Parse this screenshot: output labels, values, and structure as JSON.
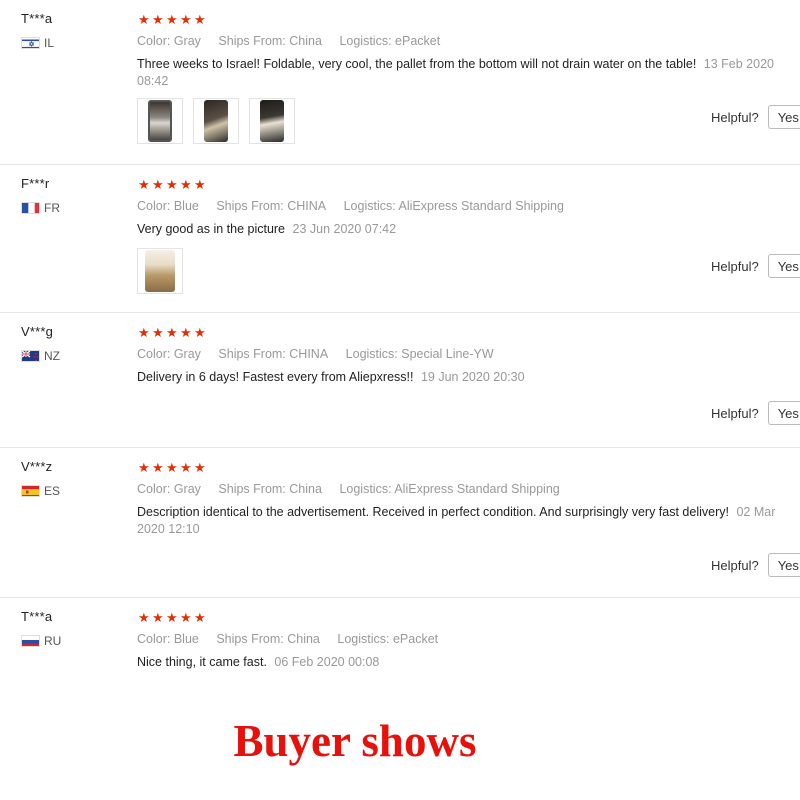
{
  "labels": {
    "color": "Color:",
    "ships_from": "Ships From:",
    "logistics": "Logistics:",
    "helpful": "Helpful?",
    "yes": "Yes"
  },
  "colors": {
    "star": "#e62e04",
    "banner": "#e8100a"
  },
  "reviews": [
    {
      "user": "T***a",
      "country": "IL",
      "flag": "flag-israel-icon",
      "rating": 5,
      "color": "Gray",
      "ships_from": "China",
      "logistics": "ePacket",
      "text": "Three weeks to Israel! Foldable, very cool, the pallet from the bottom will not drain water on the table!",
      "date": "13 Feb 2020 08:42",
      "images": [
        "review-photo-1",
        "review-photo-2",
        "review-photo-3"
      ]
    },
    {
      "user": "F***r",
      "country": "FR",
      "flag": "flag-france-icon",
      "rating": 5,
      "color": "Blue",
      "ships_from": "CHINA",
      "logistics": "AliExpress Standard Shipping",
      "text": "Very good as in the picture",
      "date": "23 Jun 2020 07:42",
      "images": [
        "review-photo-1"
      ]
    },
    {
      "user": "V***g",
      "country": "NZ",
      "flag": "flag-new-zealand-icon",
      "rating": 5,
      "color": "Gray",
      "ships_from": "CHINA",
      "logistics": "Special Line-YW",
      "text": "Delivery in 6 days! Fastest every from Aliepxress!!",
      "date": "19 Jun 2020 20:30",
      "images": []
    },
    {
      "user": "V***z",
      "country": "ES",
      "flag": "flag-spain-icon",
      "rating": 5,
      "color": "Gray",
      "ships_from": "China",
      "logistics": "AliExpress Standard Shipping",
      "text": "Description identical to the advertisement. Received in perfect condition. And surprisingly very fast delivery!",
      "date": "02 Mar 2020 12:10",
      "images": []
    },
    {
      "user": "T***a",
      "country": "RU",
      "flag": "flag-russia-icon",
      "rating": 5,
      "color": "Blue",
      "ships_from": "China",
      "logistics": "ePacket",
      "text": "Nice thing, it came fast.",
      "date": "06 Feb 2020 00:08",
      "images": []
    }
  ],
  "banner": "Buyer shows"
}
